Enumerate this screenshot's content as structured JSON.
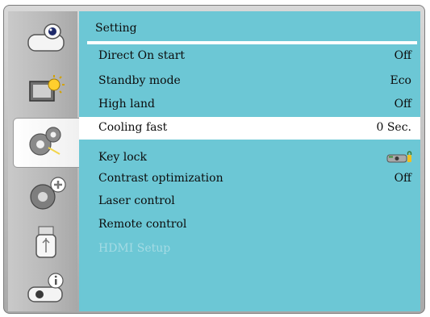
{
  "title": "Setting",
  "rows": [
    {
      "label": "Direct On start",
      "value": "Off"
    },
    {
      "label": "Standby mode",
      "value": "Eco"
    },
    {
      "label": "High land",
      "value": "Off"
    },
    {
      "label": "Cooling fast",
      "value": "0 Sec."
    },
    {
      "label": "Key lock",
      "value_icon": "key-lock-icon"
    },
    {
      "label": "Contrast optimization",
      "value": "Off"
    },
    {
      "label": "Laser control",
      "value": ""
    },
    {
      "label": "Remote control",
      "value": ""
    },
    {
      "label": "HDMI Setup",
      "value": ""
    }
  ],
  "selected_row": "Cooling fast",
  "disabled_row": "HDMI Setup",
  "sidebar": {
    "icons": [
      "projector-icon",
      "picture-brightness-icon",
      "gears-icon",
      "gear-plus-icon",
      "usb-icon",
      "projector-info-icon"
    ],
    "active": "gears-icon"
  },
  "colors": {
    "panel": "#6cc7d5",
    "selected_row": "#ffffff",
    "disabled_text": "#a4dbe4",
    "sidebar": "#bdbdbd"
  }
}
